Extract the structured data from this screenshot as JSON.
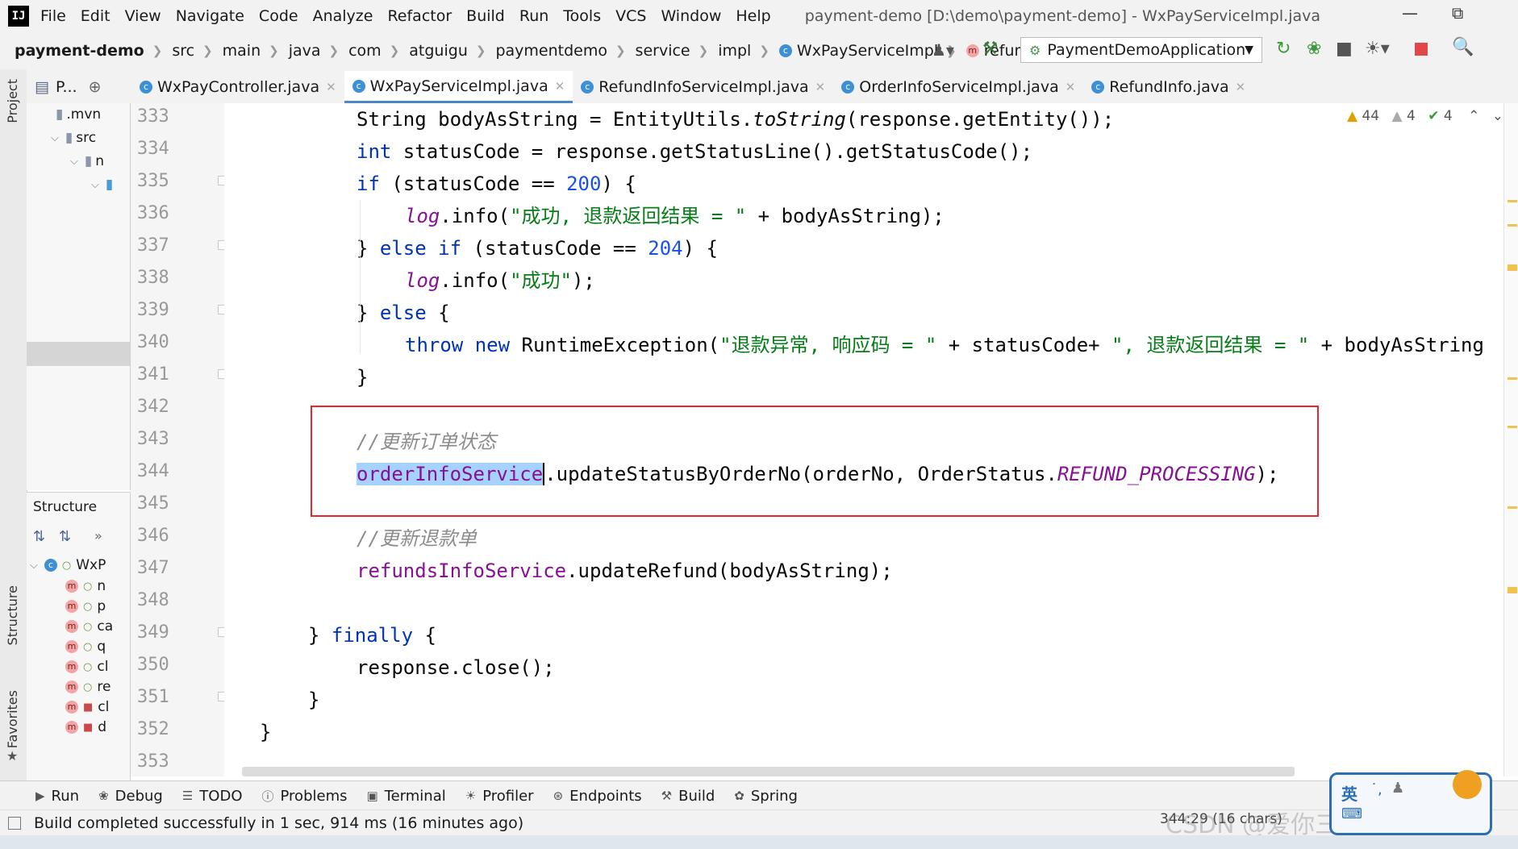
{
  "menubar": {
    "logo": "IJ",
    "items": [
      "File",
      "Edit",
      "View",
      "Navigate",
      "Code",
      "Analyze",
      "Refactor",
      "Build",
      "Run",
      "Tools",
      "VCS",
      "Window",
      "Help"
    ],
    "window_title": "payment-demo [D:\\demo\\payment-demo] - WxPayServiceImpl.java"
  },
  "navbar": {
    "project": "payment-demo",
    "crumbs": [
      "src",
      "main",
      "java",
      "com",
      "atguigu",
      "paymentdemo",
      "service",
      "impl"
    ],
    "class_crumb": "WxPayServiceImpl",
    "method_crumb": "refund",
    "run_config": "PaymentDemoApplication"
  },
  "tabs": [
    {
      "label": "WxPayController.java",
      "active": false
    },
    {
      "label": "WxPayServiceImpl.java",
      "active": true
    },
    {
      "label": "RefundInfoServiceImpl.java",
      "active": false
    },
    {
      "label": "OrderInfoServiceImpl.java",
      "active": false
    },
    {
      "label": "RefundInfo.java",
      "active": false
    }
  ],
  "project_panel": {
    "header": "P...",
    "rows": [
      ".mvn",
      "src",
      "n",
      ""
    ]
  },
  "structure_panel": {
    "title": "Structure",
    "root": "WxP",
    "methods": [
      "n",
      "p",
      "ca",
      "q",
      "cl",
      "re",
      "cl",
      "d"
    ]
  },
  "side_labels": {
    "project": "Project",
    "structure": "Structure",
    "favorites": "Favorites"
  },
  "inspections": {
    "warnings": "44",
    "weak_warnings": "4",
    "typos": "4"
  },
  "line_numbers": [
    "333",
    "334",
    "335",
    "336",
    "337",
    "338",
    "339",
    "340",
    "341",
    "342",
    "343",
    "344",
    "345",
    "346",
    "347",
    "348",
    "349",
    "350",
    "351",
    "352",
    "353"
  ],
  "code": {
    "l333_a": "String bodyAsString = EntityUtils.",
    "l333_m": "toString",
    "l333_b": "(response.getEntity());",
    "l334_kw": "int",
    "l334_b": " statusCode = response.getStatusLine().getStatusCode();",
    "l335_kw": "if",
    "l335_a": " (statusCode == ",
    "l335_num": "200",
    "l335_b": ") {",
    "l336_log": "log",
    "l336_a": ".info(",
    "l336_str": "\"成功, 退款返回结果 = \"",
    "l336_b": " + bodyAsString);",
    "l337_a": "} ",
    "l337_kw": "else if",
    "l337_b": " (statusCode == ",
    "l337_num": "204",
    "l337_c": ") {",
    "l338_log": "log",
    "l338_a": ".info(",
    "l338_str": "\"成功\"",
    "l338_b": ");",
    "l339_a": "} ",
    "l339_kw": "else",
    "l339_b": " {",
    "l340_kw": "throw new",
    "l340_a": " RuntimeException(",
    "l340_str1": "\"退款异常, 响应码 = \"",
    "l340_b": " + statusCode+ ",
    "l340_str2": "\", 退款返回结果 = \"",
    "l340_c": " + bodyAsString",
    "l341": "}",
    "l343_cm": "//更新订单状态",
    "l344_sel": "orderInfoService",
    "l344_a": ".updateStatusByOrderNo(orderNo, OrderStatus.",
    "l344_const": "REFUND_PROCESSING",
    "l344_b": ");",
    "l346_cm": "//更新退款单",
    "l347_fld": "refundsInfoService",
    "l347_a": ".updateRefund(bodyAsString);",
    "l349_a": "} ",
    "l349_kw": "finally",
    "l349_b": " {",
    "l350": "response.close();",
    "l351": "}",
    "l352": "}"
  },
  "toolwindows": [
    "Run",
    "Debug",
    "TODO",
    "Problems",
    "Terminal",
    "Profiler",
    "Endpoints",
    "Build",
    "Spring"
  ],
  "status": {
    "message": "Build completed successfully in 1 sec, 914 ms (16 minutes ago)",
    "cursor": "344:29 (16 chars)"
  },
  "ime": {
    "lang": "英"
  },
  "watermark": "CSDN @爱你三千遍斯塔克",
  "colors": {
    "keyword": "#0033b3",
    "string": "#067d17",
    "field": "#871094",
    "number": "#1750eb",
    "comment": "#8c8c8c",
    "selection": "#a6d2ff",
    "highlight_box": "#e8262b"
  }
}
